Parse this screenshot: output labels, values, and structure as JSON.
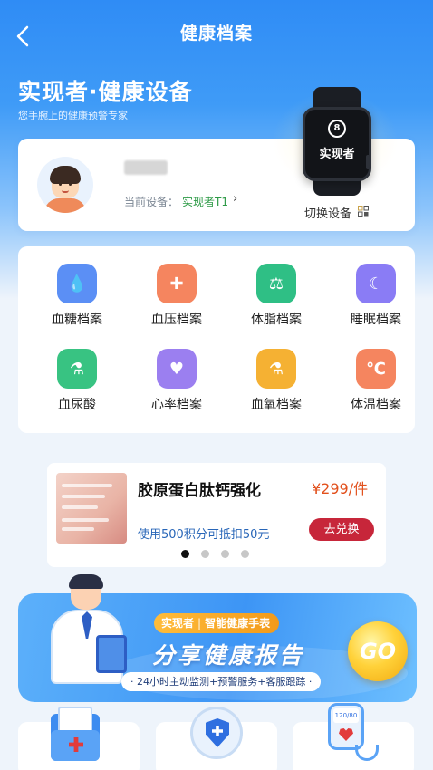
{
  "header": {
    "title": "健康档案"
  },
  "hero": {
    "title": "实现者·健康设备",
    "subtitle": "您手腕上的健康预警专家",
    "watch_brand": "实现者",
    "watch_logo": "8"
  },
  "device_card": {
    "device_label": "当前设备：",
    "device_name": "实现者T1",
    "chevron": "›",
    "switch_label": "切换设备"
  },
  "grid": [
    {
      "label": "血糖档案",
      "icon": "test-tubes-icon",
      "color": "#5b8ff5",
      "glyph": "💧"
    },
    {
      "label": "血压档案",
      "icon": "blood-pressure-icon",
      "color": "#f5855f",
      "glyph": "✚"
    },
    {
      "label": "体脂档案",
      "icon": "scale-icon",
      "color": "#2fbf85",
      "glyph": "⚖"
    },
    {
      "label": "睡眠档案",
      "icon": "moon-icon",
      "color": "#8a7cf5",
      "glyph": "☾"
    },
    {
      "label": "血尿酸",
      "icon": "test-tube-icon",
      "color": "#38c382",
      "glyph": "⚗"
    },
    {
      "label": "心率档案",
      "icon": "heart-rate-icon",
      "color": "#9b7ff0",
      "glyph": "♥"
    },
    {
      "label": "血氧档案",
      "icon": "flask-icon",
      "color": "#f5b133",
      "glyph": "⚗"
    },
    {
      "label": "体温档案",
      "icon": "thermometer-icon",
      "color": "#f5855f",
      "glyph": "℃"
    }
  ],
  "promo": {
    "title": "胶原蛋白肽钙强化",
    "price": "¥299/件",
    "desc": "使用500积分可抵扣50元",
    "button": "去兑换",
    "image_text": "益生菌肽钙粉 强身骨 年轻态"
  },
  "share": {
    "brand": "实现者",
    "brand_sub": "智能健康手表",
    "title": "分享健康报告",
    "tags": "· 24小时主动监测+预警服务+客服跟踪 ·",
    "go": "GO"
  },
  "bottom": {
    "bp_screen": "120/80"
  },
  "colors": {
    "accent": "#2f8cf5",
    "device_green": "#2d9a46",
    "price": "#e2501c",
    "button_red": "#c7263a"
  }
}
